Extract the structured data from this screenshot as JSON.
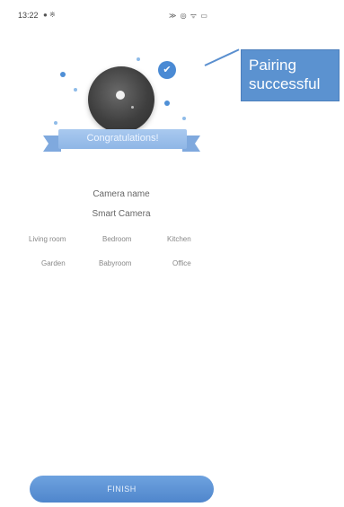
{
  "status_bar": {
    "time": "13:22",
    "left_icons": "● ※",
    "right_icons": "≫ ◎ ᯤ ▭"
  },
  "hero": {
    "banner_text": "Congratulations!",
    "check_icon": "✔"
  },
  "callout": {
    "line1": "Pairing",
    "line2": "successful"
  },
  "form": {
    "camera_name_label": "Camera name",
    "camera_name_value": "Smart Camera",
    "rooms": [
      "Living room",
      "Bedroom",
      "Kitchen",
      "Garden",
      "Babyroom",
      "Office"
    ]
  },
  "actions": {
    "finish_label": "FINISH"
  },
  "colors": {
    "accent": "#4f86cc",
    "callout": "#5b92d0",
    "ribbon": "#a9c9ef"
  }
}
